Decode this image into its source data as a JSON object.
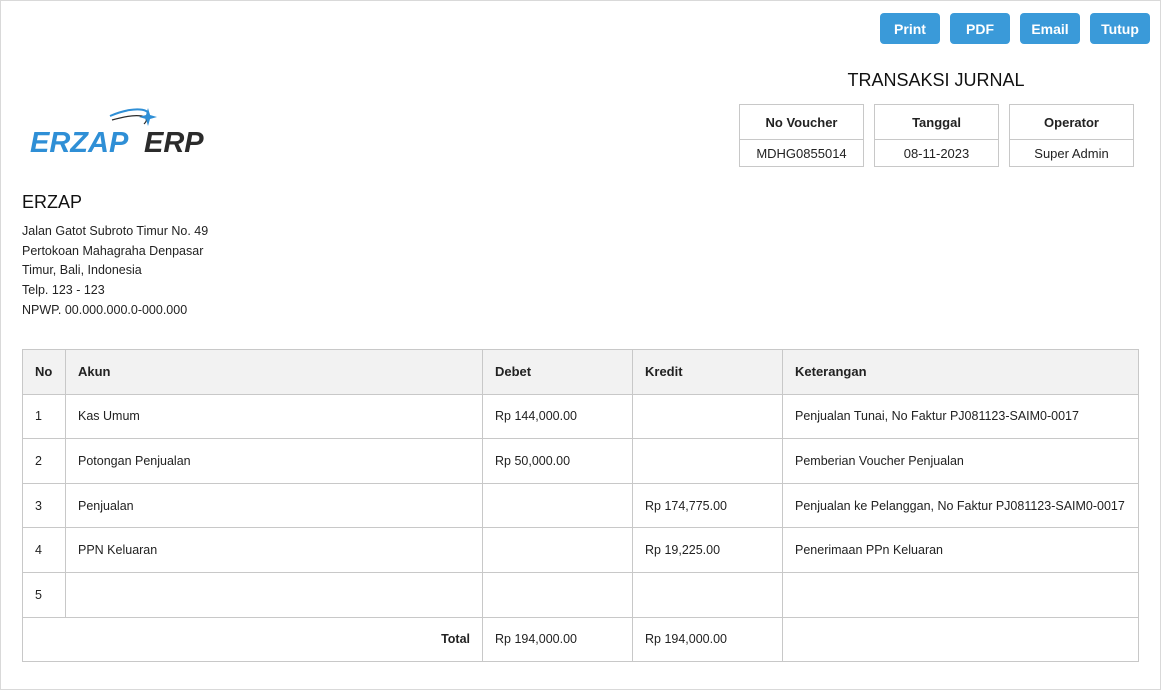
{
  "toolbar": {
    "print": "Print",
    "pdf": "PDF",
    "email": "Email",
    "tutup": "Tutup"
  },
  "document": {
    "title": "TRANSAKSI JURNAL",
    "voucher_label": "No Voucher",
    "voucher_value": "MDHG0855014",
    "date_label": "Tanggal",
    "date_value": "08-11-2023",
    "operator_label": "Operator",
    "operator_value": "Super Admin"
  },
  "logo": {
    "text_left": "ERZAP",
    "text_right": "ERP"
  },
  "company": {
    "name": "ERZAP",
    "address_lines": [
      "Jalan Gatot Subroto Timur No. 49",
      "Pertokoan Mahagraha Denpasar",
      "Timur, Bali, Indonesia",
      "Telp. 123 - 123",
      "NPWP. 00.000.000.0-000.000"
    ]
  },
  "table": {
    "headers": [
      "No",
      "Akun",
      "Debet",
      "Kredit",
      "Keterangan"
    ],
    "rows": [
      {
        "no": "1",
        "akun": "Kas Umum",
        "debet": "Rp 144,000.00",
        "kredit": "",
        "keterangan": "Penjualan Tunai, No Faktur PJ081123-SAIM0-0017"
      },
      {
        "no": "2",
        "akun": "Potongan Penjualan",
        "debet": "Rp 50,000.00",
        "kredit": "",
        "keterangan": "Pemberian Voucher Penjualan"
      },
      {
        "no": "3",
        "akun": "Penjualan",
        "debet": "",
        "kredit": "Rp 174,775.00",
        "keterangan": "Penjualan ke Pelanggan, No Faktur PJ081123-SAIM0-0017"
      },
      {
        "no": "4",
        "akun": "PPN Keluaran",
        "debet": "",
        "kredit": "Rp 19,225.00",
        "keterangan": "Penerimaan PPn Keluaran"
      },
      {
        "no": "5",
        "akun": "",
        "debet": "",
        "kredit": "",
        "keterangan": ""
      }
    ],
    "total_label": "Total",
    "total_debet": "Rp 194,000.00",
    "total_kredit": "Rp 194,000.00"
  },
  "colors": {
    "button": "#3a9ad9",
    "logo_blue": "#2f8fd6",
    "logo_dark": "#2b2b2b"
  }
}
